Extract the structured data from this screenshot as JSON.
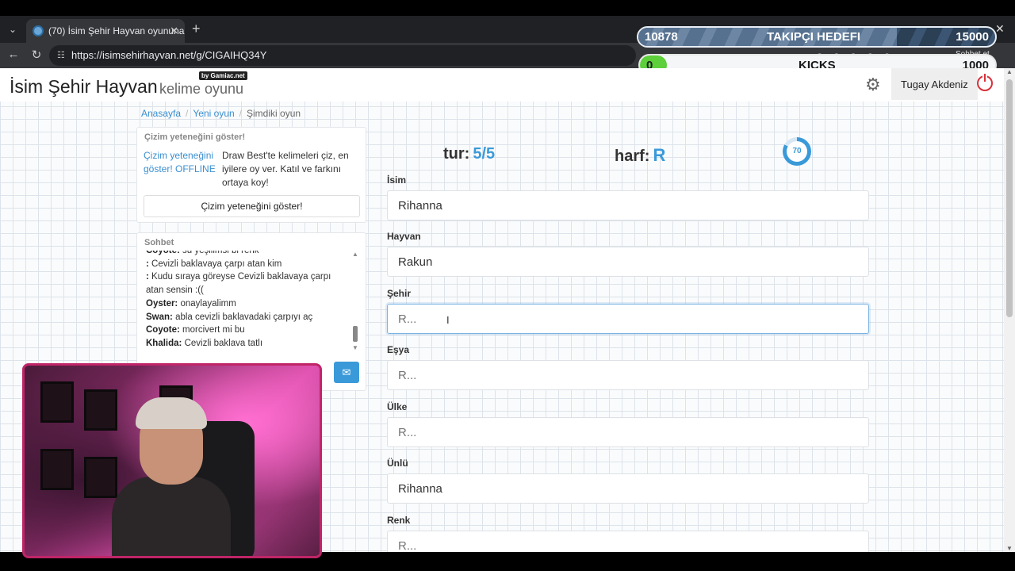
{
  "browser": {
    "tab_title": "(70) İsim Şehir Hayvan oyununa ka",
    "url": "https://isimsehirhayvan.net/g/CIGAIHQ34Y",
    "ext_label": "Sohbet et"
  },
  "overlay": {
    "follower_current": "10878",
    "follower_title": "TAKIPÇI HEDEFI",
    "follower_goal": "15000",
    "follower_progress": 0.7252,
    "kicks_current": "0",
    "kicks_title": "KICKS",
    "kicks_goal": "1000"
  },
  "header": {
    "brand": "İsim Şehir Hayvan",
    "brand_sub": "kelime oyunu",
    "by": "by Gamiac.net",
    "user": "Tugay Akdeniz"
  },
  "breadcrumb": [
    "Anasayfa",
    "Yeni oyun",
    "Şimdiki oyun"
  ],
  "promo": {
    "title": "Çizim yeteneğini göster!",
    "image_alt": "Çizim yeteneğini göster! OFFLINE",
    "text": "Draw Best'te kelimeleri çiz, en iyilere oy ver. Katıl ve farkını ortaya koy!",
    "button": "Çizim yeteneğini göster!"
  },
  "chat": {
    "title": "Sohbet",
    "messages": [
      {
        "user": "Coyote:",
        "text": "su yeşilimsi bi renk"
      },
      {
        "user": ":",
        "text": "Cevizli baklavaya çarpı atan kim"
      },
      {
        "user": ":",
        "text": "Kudu sıraya göreyse Cevizli baklavaya çarpı atan sensin :(("
      },
      {
        "user": "Oyster:",
        "text": "onaylayalimm"
      },
      {
        "user": "Swan:",
        "text": "abla cevizli baklavadaki çarpıyı aç"
      },
      {
        "user": "Coyote:",
        "text": "morcivert mi bu"
      },
      {
        "user": "Khalida:",
        "text": "Cevizli baklava tatlı"
      }
    ]
  },
  "game": {
    "round_label": "tur:",
    "round_value": "5/5",
    "letter_label": "harf:",
    "letter_value": "R",
    "timer": "70",
    "timer_fraction": 0.83,
    "fields": [
      {
        "label": "İsim",
        "value": "Rihanna",
        "placeholder": "R..."
      },
      {
        "label": "Hayvan",
        "value": "Rakun",
        "placeholder": "R..."
      },
      {
        "label": "Şehir",
        "value": "",
        "placeholder": "R..."
      },
      {
        "label": "Eşya",
        "value": "",
        "placeholder": "R..."
      },
      {
        "label": "Ülke",
        "value": "",
        "placeholder": "R..."
      },
      {
        "label": "Ünlü",
        "value": "Rihanna",
        "placeholder": "R..."
      },
      {
        "label": "Renk",
        "value": "",
        "placeholder": "R..."
      }
    ]
  }
}
